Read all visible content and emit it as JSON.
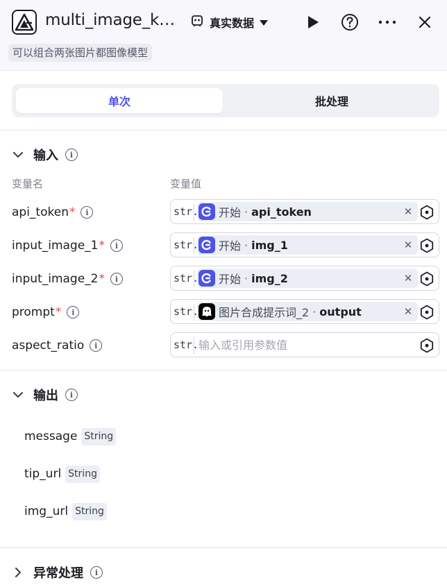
{
  "header": {
    "title": "multi_image_k…",
    "data_mode": "真实数据",
    "subtitle": "可以组合两张图片都图像模型"
  },
  "tabs": [
    {
      "label": "单次",
      "active": true
    },
    {
      "label": "批处理",
      "active": false
    }
  ],
  "input_section": {
    "title": "输入",
    "col_name": "变量名",
    "col_value": "变量值",
    "placeholder": "输入或引用参数值",
    "type_tag": "str.",
    "rows": [
      {
        "name": "api_token",
        "required": "*",
        "ref_node": "开始",
        "ref_var": "api_token",
        "icon": "start-icon"
      },
      {
        "name": "input_image_1",
        "required": "*",
        "ref_node": "开始",
        "ref_var": "img_1",
        "icon": "start-icon"
      },
      {
        "name": "input_image_2",
        "required": "*",
        "ref_node": "开始",
        "ref_var": "img_2",
        "icon": "start-icon"
      },
      {
        "name": "prompt",
        "required": "*",
        "ref_node": "图片合成提示词_2",
        "ref_var": "output",
        "icon": "ghost-icon"
      },
      {
        "name": "aspect_ratio",
        "required": "",
        "ref_node": "",
        "ref_var": "",
        "icon": ""
      }
    ]
  },
  "output_section": {
    "title": "输出",
    "items": [
      {
        "name": "message",
        "type": "String"
      },
      {
        "name": "tip_url",
        "type": "String"
      },
      {
        "name": "img_url",
        "type": "String"
      }
    ]
  },
  "exception_section": {
    "title": "异常处理"
  },
  "colors": {
    "accent": "#4d53e8",
    "required": "#e5484d",
    "header_bg": "#f7f7fc",
    "chip_bg": "#eceef5"
  }
}
